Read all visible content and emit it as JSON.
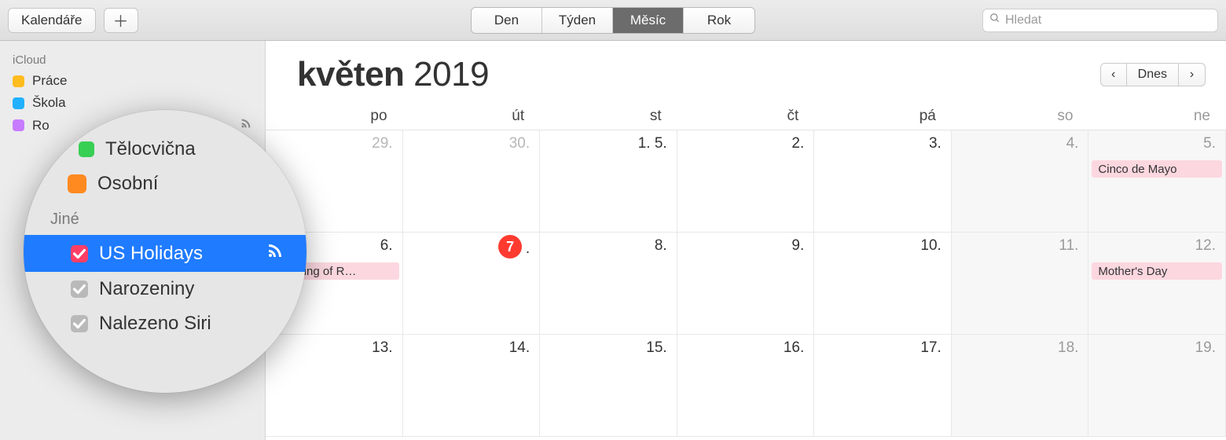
{
  "toolbar": {
    "calendars_label": "Kalendáře",
    "views": {
      "day": "Den",
      "week": "Týden",
      "month": "Měsíc",
      "year": "Rok"
    },
    "search_placeholder": "Hledat",
    "today_label": "Dnes"
  },
  "sidebar": {
    "groups": [
      {
        "name": "iCloud",
        "items": [
          {
            "label": "Práce",
            "color": "#ffbc1f"
          },
          {
            "label": "Škola",
            "color": "#1fb1ff"
          },
          {
            "label": "Ro",
            "color": "#c77cff",
            "has_rss": true
          }
        ]
      }
    ]
  },
  "zoom": {
    "top_items": [
      {
        "label": "Tělocvična",
        "color_class": "green"
      },
      {
        "label": "Osobní",
        "color_class": "orange"
      }
    ],
    "group_label": "Jiné",
    "items": [
      {
        "label": "US Holidays",
        "checkbox": "pink",
        "selected": true,
        "rss": true
      },
      {
        "label": "Narozeniny",
        "checkbox": "grey"
      },
      {
        "label": "Nalezeno Siri",
        "checkbox": "grey"
      }
    ]
  },
  "calendar": {
    "month_bold": "květen",
    "month_year": "2019",
    "dow": [
      "po",
      "út",
      "st",
      "čt",
      "pá",
      "so",
      "ne"
    ],
    "weeks": [
      [
        {
          "n": "29.",
          "dim": true
        },
        {
          "n": "30.",
          "dim": true
        },
        {
          "n": "1. 5."
        },
        {
          "n": "2."
        },
        {
          "n": "3."
        },
        {
          "n": "4.",
          "wknd": true
        },
        {
          "n": "5.",
          "wknd": true,
          "event": "Cinco de Mayo"
        }
      ],
      [
        {
          "n": "6.",
          "event": "eginning of R…"
        },
        {
          "n": "7.",
          "today": true
        },
        {
          "n": "8."
        },
        {
          "n": "9."
        },
        {
          "n": "10."
        },
        {
          "n": "11.",
          "wknd": true
        },
        {
          "n": "12.",
          "wknd": true,
          "event": "Mother's Day"
        }
      ],
      [
        {
          "n": "13."
        },
        {
          "n": "14."
        },
        {
          "n": "15."
        },
        {
          "n": "16."
        },
        {
          "n": "17."
        },
        {
          "n": "18.",
          "wknd": true
        },
        {
          "n": "19.",
          "wknd": true
        }
      ]
    ]
  }
}
